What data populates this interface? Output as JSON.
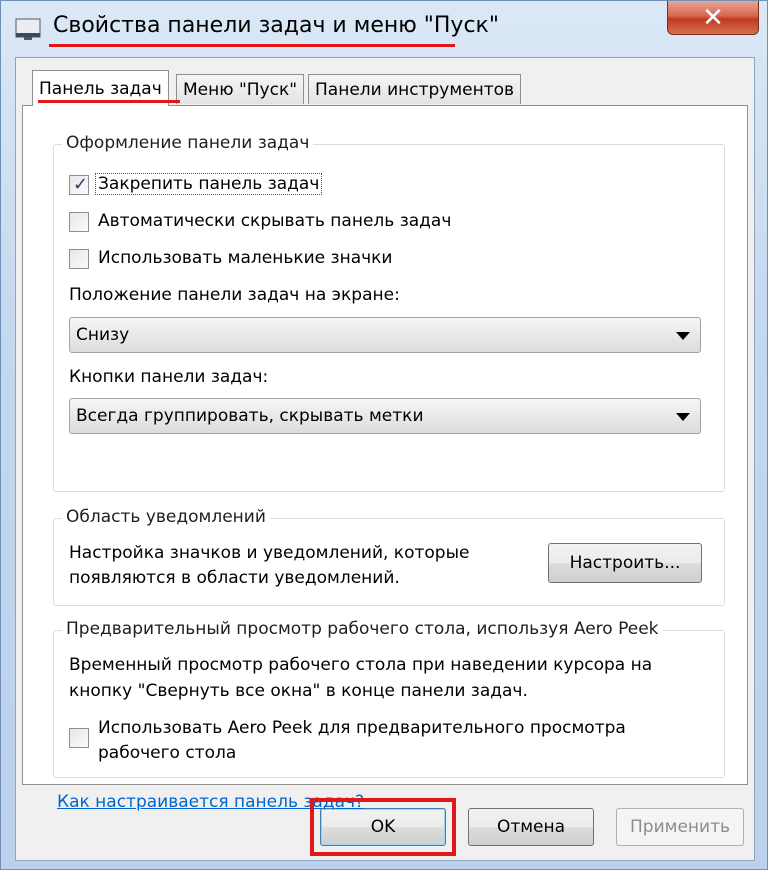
{
  "window": {
    "title": "Свойства панели задач и меню \"Пуск\"",
    "close_symbol": "✕",
    "accent_color": "#e01818"
  },
  "tabs": [
    {
      "label": "Панель задач",
      "active": true
    },
    {
      "label": "Меню \"Пуск\"",
      "active": false
    },
    {
      "label": "Панели инструментов",
      "active": false
    }
  ],
  "taskbar_group": {
    "legend": "Оформление панели задач",
    "checkboxes": [
      {
        "label": "Закрепить панель задач",
        "checked": true
      },
      {
        "label": "Автоматически скрывать панель задач",
        "checked": false
      },
      {
        "label": "Использовать маленькие значки",
        "checked": false
      }
    ],
    "position_label": "Положение панели задач на экране:",
    "position_value": "Снизу",
    "buttons_label": "Кнопки панели задач:",
    "buttons_value": "Всегда группировать, скрывать метки"
  },
  "notification_group": {
    "legend": "Область уведомлений",
    "text_line1": "Настройка значков и уведомлений, которые",
    "text_line2": "появляются в области уведомлений.",
    "customize_button": "Настроить..."
  },
  "aero_group": {
    "legend": "Предварительный просмотр рабочего стола, используя Aero Peek",
    "text_line1": "Временный просмотр рабочего стола при наведении курсора на",
    "text_line2": "кнопку \"Свернуть все окна\" в конце панели задач.",
    "checkbox_line1": "Использовать Aero Peek для предварительного просмотра",
    "checkbox_line2": "рабочего стола",
    "checkbox_checked": false
  },
  "help_link": "Как настраивается панель задач?",
  "footer": {
    "ok": "OK",
    "cancel": "Отмена",
    "apply": "Применить"
  }
}
